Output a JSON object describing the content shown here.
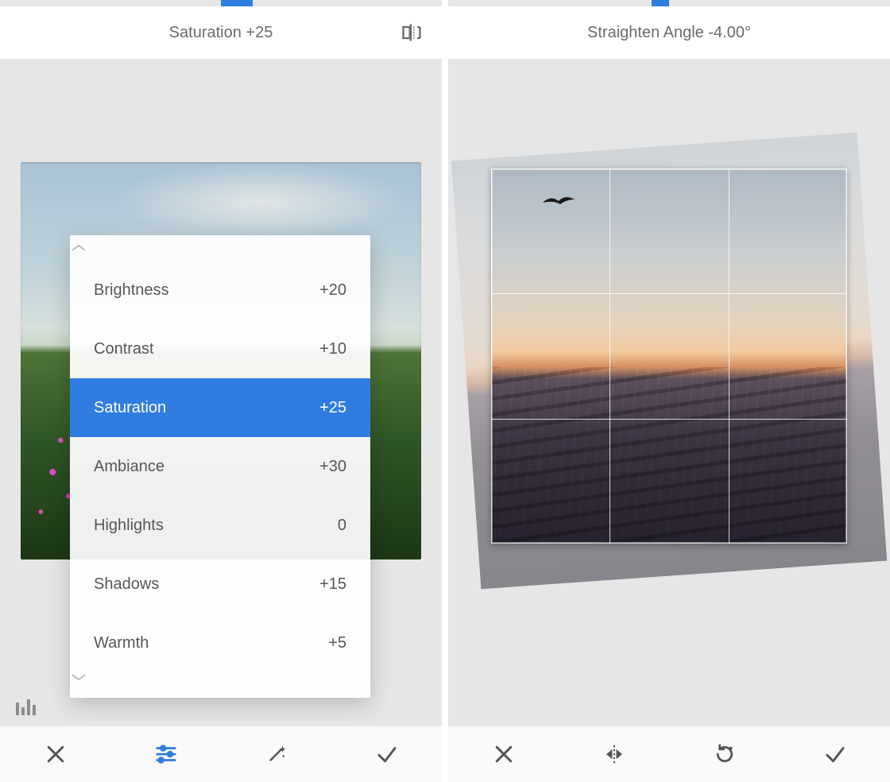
{
  "colors": {
    "accent": "#2f7de1",
    "muted": "#6b6b6b"
  },
  "left": {
    "progress_percent": 53,
    "header_title": "Saturation +25",
    "header_icon": "compare-icon",
    "adjustments": [
      {
        "label": "Brightness",
        "value": "+20",
        "selected": false
      },
      {
        "label": "Contrast",
        "value": "+10",
        "selected": false
      },
      {
        "label": "Saturation",
        "value": "+25",
        "selected": true
      },
      {
        "label": "Ambiance",
        "value": "+30",
        "selected": false
      },
      {
        "label": "Highlights",
        "value": "0",
        "selected": false
      },
      {
        "label": "Shadows",
        "value": "+15",
        "selected": false
      },
      {
        "label": "Warmth",
        "value": "+5",
        "selected": false
      }
    ],
    "nav": {
      "close": "close-icon",
      "tune": "tune-sliders-icon",
      "wand": "auto-wand-icon",
      "accept": "check-icon",
      "active": "tune"
    },
    "histogram_icon": "histogram-icon"
  },
  "right": {
    "progress_percent": 48,
    "header_title": "Straighten Angle -4.00°",
    "rotation_deg": -4.0,
    "nav": {
      "close": "close-icon",
      "flip": "flip-horizontal-icon",
      "rotate": "rotate-cw-icon",
      "accept": "check-icon"
    }
  }
}
